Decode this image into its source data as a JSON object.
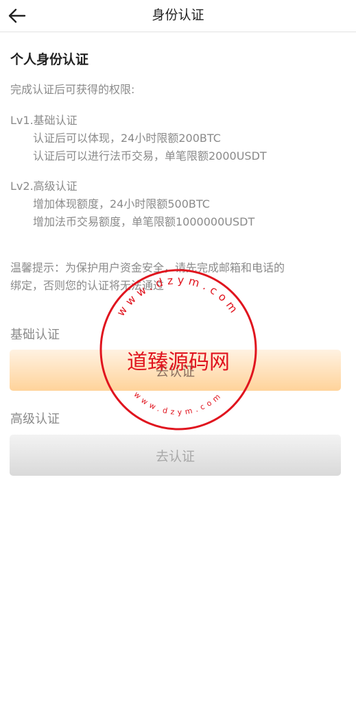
{
  "header": {
    "title": "身份认证",
    "back_icon": "arrow-left-icon"
  },
  "main": {
    "section_title": "个人身份认证",
    "intro": "完成认证后可获得的权限:",
    "levels": [
      {
        "title": "Lv1.基础认证",
        "items": [
          "认证后可以体现，24小时限额200BTC",
          "认证后可以进行法币交易，单笔限额2000USDT"
        ]
      },
      {
        "title": "Lv2.高级认证",
        "items": [
          "增加体现额度，24小时限额500BTC",
          "增加法币交易额度，单笔限额1000000USDT"
        ]
      }
    ],
    "tip_line1": "温馨提示：为保护用户资金安全，请先完成邮箱和电话的",
    "tip_line2": "绑定，否则您的认证将无法通过",
    "basic": {
      "label": "基础认证",
      "button": "去认证"
    },
    "advanced": {
      "label": "高级认证",
      "button": "去认证"
    }
  },
  "watermark": {
    "center_text": "道臻源码网",
    "ring_top": "www.dzym.com",
    "ring_bottom": "www.dzym.com",
    "color": "#e0141e"
  }
}
